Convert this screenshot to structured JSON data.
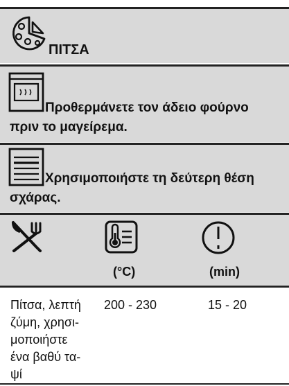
{
  "section1": {
    "icon": "pizza-icon",
    "title": "ΠΙΤΣΑ"
  },
  "section2": {
    "icon": "oven-preheat-icon",
    "text": "Προθερμάνετε τον άδειο φούρνο πριν το μαγείρεμα."
  },
  "section3": {
    "icon": "shelf-position-icon",
    "text": "Χρησιμοποιήστε τη δεύτερη θέση σχάρας."
  },
  "table": {
    "header_icons": [
      "fork-knife-icon",
      "thermometer-icon",
      "clock-icon"
    ],
    "headers": [
      "",
      "(°C)",
      "(min)"
    ],
    "row": {
      "food_lines": [
        "Πίτσα, λεπτή",
        "ζύμη, χρησι-",
        "μοποιήστε",
        "ένα βαθύ τα-",
        "ψί"
      ],
      "temperature": "200 - 230",
      "time": "15 - 20"
    }
  }
}
